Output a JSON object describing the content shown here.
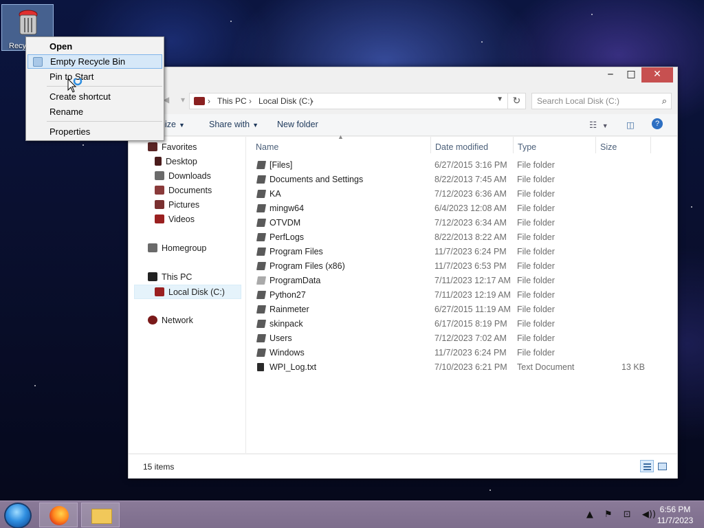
{
  "desktop": {
    "recycle_bin_label": "Recy"
  },
  "context_menu": {
    "items": [
      {
        "label": "Open",
        "bold": true
      },
      {
        "label": "Empty Recycle Bin",
        "highlighted": true
      },
      {
        "label": "Pin to Start"
      },
      {
        "label": "Create shortcut"
      },
      {
        "label": "Rename"
      },
      {
        "label": "Properties"
      }
    ]
  },
  "window": {
    "controls": {
      "minimize": "‒",
      "maximize": "□",
      "close": "✕"
    },
    "address": {
      "crumbs": [
        "This PC",
        "Local Disk (C:)"
      ]
    },
    "search_placeholder": "Search Local Disk (C:)",
    "toolbar": {
      "organize": "nize",
      "share_with": "Share with",
      "new_folder": "New folder"
    },
    "nav": {
      "favorites": "Favorites",
      "desktop": "Desktop",
      "downloads": "Downloads",
      "documents": "Documents",
      "pictures": "Pictures",
      "videos": "Videos",
      "homegroup": "Homegroup",
      "this_pc": "This PC",
      "local_disk": "Local Disk (C:)",
      "network": "Network"
    },
    "columns": {
      "name": "Name",
      "date": "Date modified",
      "type": "Type",
      "size": "Size"
    },
    "files": [
      {
        "name": "[Files]",
        "date": "6/27/2015 3:16 PM",
        "type": "File folder",
        "size": ""
      },
      {
        "name": "Documents and Settings",
        "date": "8/22/2013 7:45 AM",
        "type": "File folder",
        "size": ""
      },
      {
        "name": "KA",
        "date": "7/12/2023 6:36 AM",
        "type": "File folder",
        "size": ""
      },
      {
        "name": "mingw64",
        "date": "6/4/2023 12:08 AM",
        "type": "File folder",
        "size": ""
      },
      {
        "name": "OTVDM",
        "date": "7/12/2023 6:34 AM",
        "type": "File folder",
        "size": ""
      },
      {
        "name": "PerfLogs",
        "date": "8/22/2013 8:22 AM",
        "type": "File folder",
        "size": ""
      },
      {
        "name": "Program Files",
        "date": "11/7/2023 6:24 PM",
        "type": "File folder",
        "size": ""
      },
      {
        "name": "Program Files (x86)",
        "date": "11/7/2023 6:53 PM",
        "type": "File folder",
        "size": ""
      },
      {
        "name": "ProgramData",
        "date": "7/11/2023 12:17 AM",
        "type": "File folder",
        "size": ""
      },
      {
        "name": "Python27",
        "date": "7/11/2023 12:19 AM",
        "type": "File folder",
        "size": ""
      },
      {
        "name": "Rainmeter",
        "date": "6/27/2015 11:19 AM",
        "type": "File folder",
        "size": ""
      },
      {
        "name": "skinpack",
        "date": "6/17/2015 8:19 PM",
        "type": "File folder",
        "size": ""
      },
      {
        "name": "Users",
        "date": "7/12/2023 7:02 AM",
        "type": "File folder",
        "size": ""
      },
      {
        "name": "Windows",
        "date": "11/7/2023 6:24 PM",
        "type": "File folder",
        "size": ""
      },
      {
        "name": "WPI_Log.txt",
        "date": "7/10/2023 6:21 PM",
        "type": "Text Document",
        "size": "13 KB"
      }
    ],
    "status": "15 items"
  },
  "taskbar": {
    "time": "6:56 PM",
    "date": "11/7/2023"
  }
}
